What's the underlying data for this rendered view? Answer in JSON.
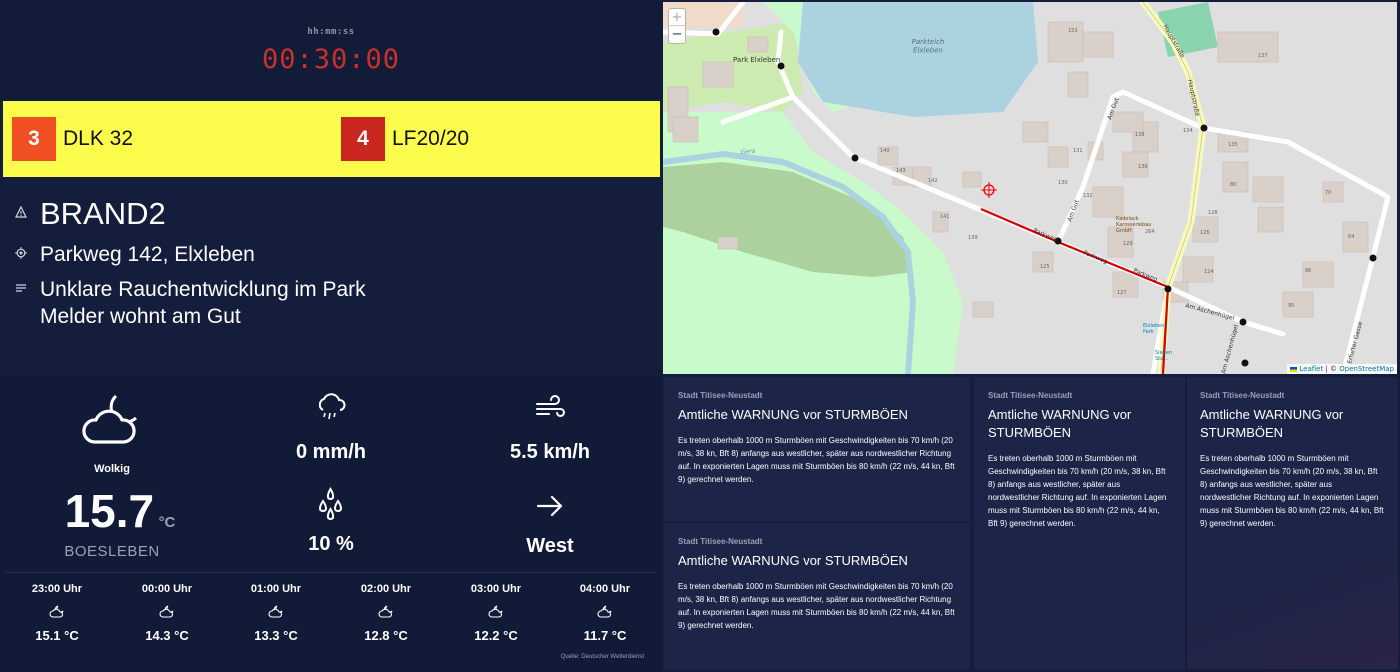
{
  "timer": {
    "format": "hh:mm:ss",
    "value": "00:30:00",
    "color": "#c7312c"
  },
  "vehicles": [
    {
      "count": "3",
      "name": "DLK 32",
      "badge_color": "#f04f23"
    },
    {
      "count": "4",
      "name": "LF20/20",
      "badge_color": "#c8261f"
    }
  ],
  "alarm": {
    "keyword": "BRAND2",
    "address": "Parkweg 142, Elxleben",
    "notes": [
      "Unklare Rauchentwicklung im Park",
      "Melder wohnt am Gut"
    ],
    "icons": {
      "keyword": "warning-triangle-icon",
      "address": "location-target-icon",
      "notes": "notes-lines-icon"
    }
  },
  "map": {
    "zoom_in": "+",
    "zoom_out": "−",
    "attribution_leaflet": "Leaflet",
    "attribution_sep": " | © ",
    "attribution_osm": "OpenStreetMap",
    "labels": {
      "pond": "Parkteich\nElxleben",
      "park": "Park Elxleben",
      "hauptstrasse": "Hauptstraße",
      "hauptstrasse2": "Hauptstraße",
      "parkweg1": "Parkweg",
      "parkweg2": "Parkweg",
      "parkweg3": "Parkweg",
      "amgut": "Am Gut",
      "amgut2": "Am Gut",
      "amaschenhugel": "Am Aschenhügel",
      "erfurtergasse": "Erfurter Gasse",
      "amaschenhugel2": "Am Aschenhügel",
      "gera": "Gera",
      "kadelack": "Kadelack\nKarosseriebau\nGmbH",
      "busstop": "Elxleben\nPark",
      "busstop2": "Sieben\nSta..."
    },
    "house_numbers": [
      "153",
      "137",
      "134",
      "131",
      "130",
      "136",
      "80",
      "132",
      "141",
      "143",
      "142",
      "140",
      "139",
      "125",
      "127",
      "129",
      "126",
      "124",
      "128",
      "264",
      "86",
      "95",
      "64",
      "70",
      "138",
      "135"
    ]
  },
  "weather": {
    "condition_icon": "cloud-moon-icon",
    "condition": "Wolkig",
    "temperature": "15.7",
    "temperature_unit": "°C",
    "station": "BOESLEBEN",
    "precipitation_icon": "cloud-rain-icon",
    "precipitation": "0 mm/h",
    "humidity_icon": "droplets-icon",
    "humidity": "10 %",
    "wind_icon": "wind-icon",
    "wind_speed": "5.5 km/h",
    "wind_dir_icon": "arrow-right-icon",
    "wind_direction": "West",
    "forecast": [
      {
        "time": "23:00 Uhr",
        "icon": "partly-cloudy-night-icon",
        "temp": "15.1 °C"
      },
      {
        "time": "00:00 Uhr",
        "icon": "partly-cloudy-night-icon",
        "temp": "14.3 °C"
      },
      {
        "time": "01:00 Uhr",
        "icon": "partly-cloudy-night-icon",
        "temp": "13.3 °C"
      },
      {
        "time": "02:00 Uhr",
        "icon": "partly-cloudy-night-icon",
        "temp": "12.8 °C"
      },
      {
        "time": "03:00 Uhr",
        "icon": "partly-cloudy-night-icon",
        "temp": "12.2 °C"
      },
      {
        "time": "04:00 Uhr",
        "icon": "partly-cloudy-night-icon",
        "temp": "11.7 °C"
      }
    ],
    "source": "Quelle: Deutscher Wetterdienst"
  },
  "warnings": [
    {
      "area": "Stadt Titisee-Neustadt",
      "title": "Amtliche WARNUNG vor STURMBÖEN",
      "body": "Es treten oberhalb 1000 m Sturmböen mit Geschwindigkeiten bis 70 km/h (20 m/s, 38 kn, Bft 8) anfangs aus westlicher, später aus nordwestlicher Richtung auf. In exponierten Lagen muss mit Sturmböen bis 80 km/h (22 m/s, 44 kn, Bft 9) gerechnet werden."
    },
    {
      "area": "Stadt Titisee-Neustadt",
      "title": "Amtliche WARNUNG vor STURMBÖEN",
      "body": "Es treten oberhalb 1000 m Sturmböen mit Geschwindigkeiten bis 70 km/h (20 m/s, 38 kn, Bft 8) anfangs aus westlicher, später aus nordwestlicher Richtung auf. In exponierten Lagen muss mit Sturmböen bis 80 km/h (22 m/s, 44 kn, Bft 9) gerechnet werden."
    },
    {
      "area": "Stadt Titisee-Neustadt",
      "title": "Amtliche WARNUNG vor STURMBÖEN",
      "body": "Es treten oberhalb 1000 m Sturmböen mit Geschwindigkeiten bis 70 km/h (20 m/s, 38 kn, Bft 8) anfangs aus westlicher, später aus nordwestlicher Richtung auf. In exponierten Lagen muss mit Sturmböen bis 80 km/h (22 m/s, 44 kn, Bft 9) gerechnet werden."
    },
    {
      "area": "Stadt Titisee-Neustadt",
      "title": "Amtliche WARNUNG vor STURMBÖEN",
      "body": "Es treten oberhalb 1000 m Sturmböen mit Geschwindigkeiten bis 70 km/h (20 m/s, 38 kn, Bft 8) anfangs aus westlicher, später aus nordwestlicher Richtung auf. In exponierten Lagen muss mit Sturmböen bis 80 km/h (22 m/s, 44 kn, Bft 9) gerechnet werden."
    }
  ],
  "colors": {
    "background": "#141d3c",
    "vehicle_bar": "#fcfc4c",
    "route": "#d40000",
    "card": "#1c2447"
  }
}
